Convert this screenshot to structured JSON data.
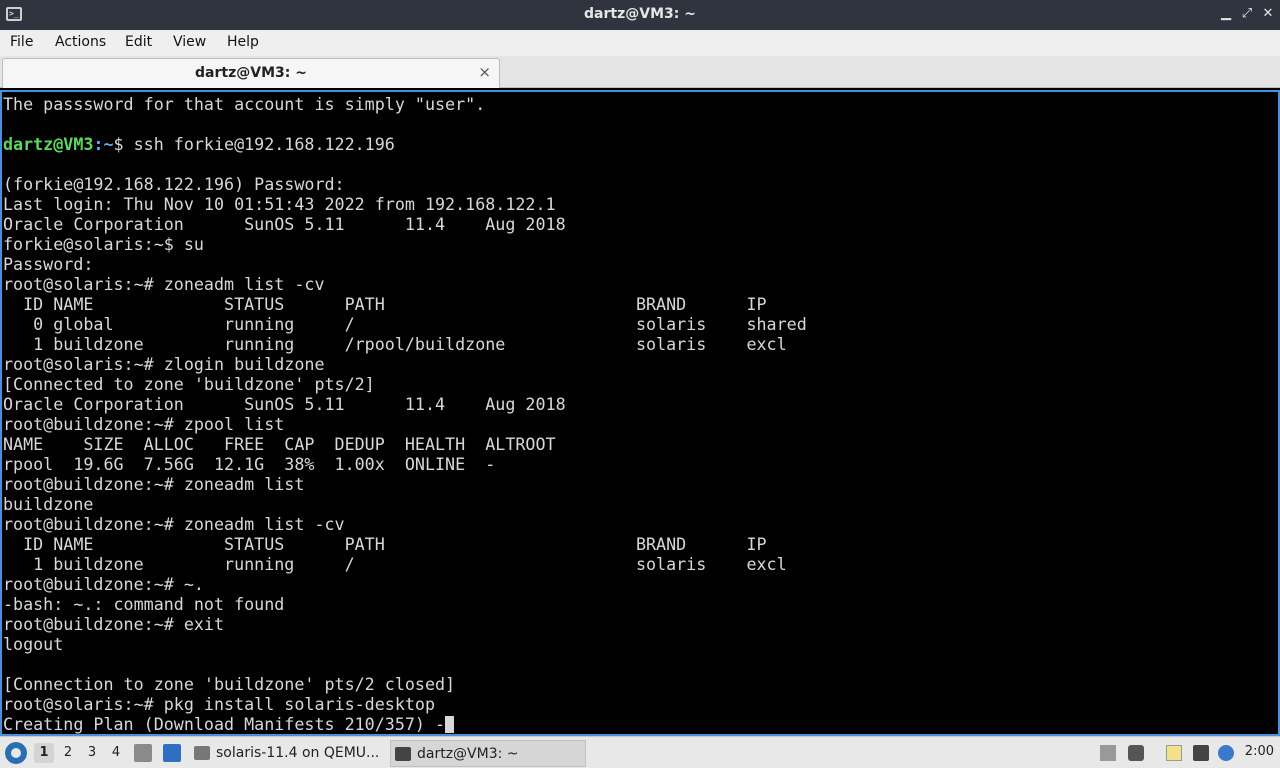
{
  "window": {
    "title": "dartz@VM3: ~",
    "minimize_label": "▁",
    "maximize_label": "⤢",
    "close_label": "✕"
  },
  "menu": {
    "file": "File",
    "actions": "Actions",
    "edit": "Edit",
    "view": "View",
    "help": "Help"
  },
  "tab": {
    "label": "dartz@VM3: ~",
    "close": "×"
  },
  "terminal": {
    "prompt_user": "dartz@VM3",
    "prompt_path": ":~",
    "lines": [
      "The passsword for that account is simply \"user\".",
      "",
      "$ ssh forkie@192.168.122.196",
      "",
      "(forkie@192.168.122.196) Password:",
      "Last login: Thu Nov 10 01:51:43 2022 from 192.168.122.1",
      "Oracle Corporation      SunOS 5.11      11.4    Aug 2018",
      "forkie@solaris:~$ su",
      "Password:",
      "root@solaris:~# zoneadm list -cv",
      "  ID NAME             STATUS      PATH                         BRAND      IP",
      "   0 global           running     /                            solaris    shared",
      "   1 buildzone        running     /rpool/buildzone             solaris    excl",
      "root@solaris:~# zlogin buildzone",
      "[Connected to zone 'buildzone' pts/2]",
      "Oracle Corporation      SunOS 5.11      11.4    Aug 2018",
      "root@buildzone:~# zpool list",
      "NAME    SIZE  ALLOC   FREE  CAP  DEDUP  HEALTH  ALTROOT",
      "rpool  19.6G  7.56G  12.1G  38%  1.00x  ONLINE  -",
      "root@buildzone:~# zoneadm list",
      "buildzone",
      "root@buildzone:~# zoneadm list -cv",
      "  ID NAME             STATUS      PATH                         BRAND      IP",
      "   1 buildzone        running     /                            solaris    excl",
      "root@buildzone:~# ~.",
      "-bash: ~.: command not found",
      "root@buildzone:~# exit",
      "logout",
      "",
      "[Connection to zone 'buildzone' pts/2 closed]",
      "root@solaris:~# pkg install solaris-desktop",
      "Creating Plan (Download Manifests 210/357) -"
    ]
  },
  "taskbar": {
    "workspaces": [
      "1",
      "2",
      "3",
      "4"
    ],
    "tasks": [
      {
        "label": "solaris-11.4 on QEMU..."
      },
      {
        "label": "dartz@VM3: ~"
      }
    ],
    "clock": "2:00"
  },
  "colors": {
    "titlebar": "#2f343f",
    "terminal_bg": "#000000",
    "prompt_user": "#5fd75f",
    "prompt_path": "#6aa8e8",
    "focus_border": "#4a90d9"
  }
}
